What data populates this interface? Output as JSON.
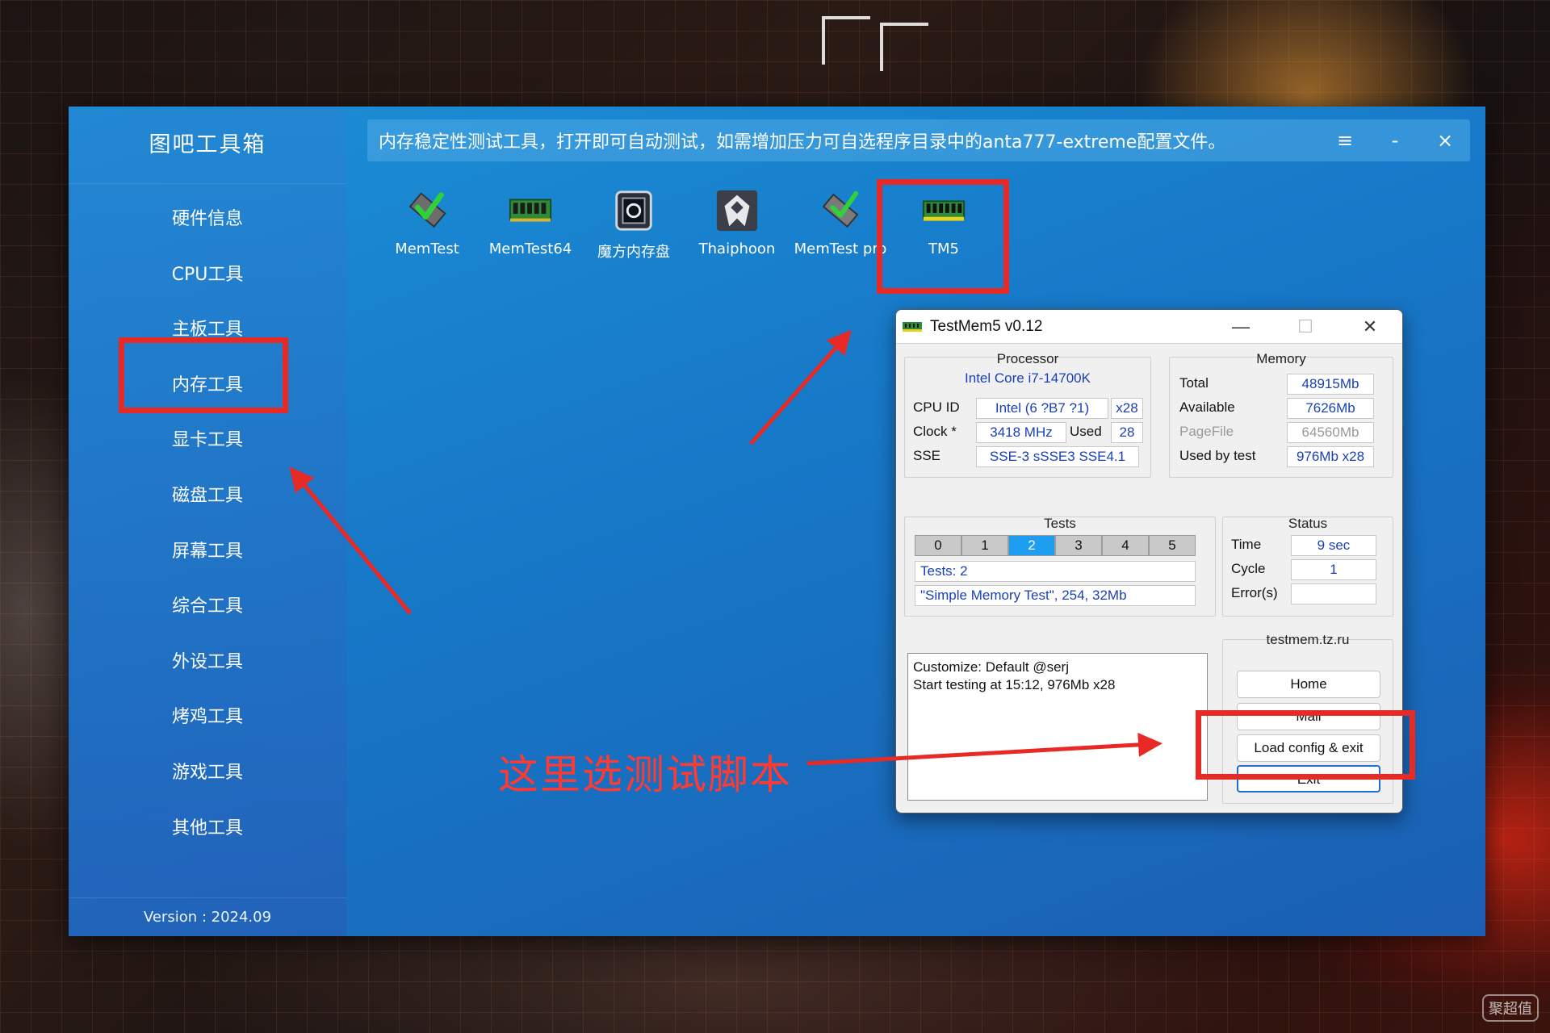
{
  "app": {
    "title": "图吧工具箱",
    "version": "Version : 2024.09",
    "description": "内存稳定性测试工具，打开即可自动测试，如需增加压力可自选程序目录中的anta777-extreme配置文件。",
    "window_controls": {
      "menu": "≡",
      "minimize": "-",
      "close": "×"
    }
  },
  "sidebar": {
    "items": [
      {
        "label": "硬件信息"
      },
      {
        "label": "CPU工具"
      },
      {
        "label": "主板工具"
      },
      {
        "label": "内存工具",
        "active": true
      },
      {
        "label": "显卡工具"
      },
      {
        "label": "磁盘工具"
      },
      {
        "label": "屏幕工具"
      },
      {
        "label": "综合工具"
      },
      {
        "label": "外设工具"
      },
      {
        "label": "烤鸡工具"
      },
      {
        "label": "游戏工具"
      },
      {
        "label": "其他工具"
      }
    ]
  },
  "tools": [
    {
      "label": "MemTest",
      "icon": "memtest-icon"
    },
    {
      "label": "MemTest64",
      "icon": "ram-stick-icon"
    },
    {
      "label": "魔方内存盘",
      "icon": "ramdisk-icon"
    },
    {
      "label": "Thaiphoon",
      "icon": "thaiphoon-icon"
    },
    {
      "label": "MemTest pro",
      "icon": "memtest-pro-icon"
    },
    {
      "label": "TM5",
      "icon": "tm5-icon"
    }
  ],
  "tm5": {
    "title": "TestMem5 v0.12",
    "controls": {
      "minimize": "—",
      "maximize": "☐",
      "close": "✕"
    },
    "processor": {
      "title": "Processor",
      "name": "Intel Core i7-14700K",
      "cpu_id_label": "CPU ID",
      "cpu_id": "Intel  (6 ?B7 ?1)",
      "threads": "x28",
      "clock_label": "Clock *",
      "clock": "3418 MHz",
      "used_label": "Used",
      "used": "28",
      "sse_label": "SSE",
      "sse": "SSE-3 sSSE3 SSE4.1"
    },
    "memory": {
      "title": "Memory",
      "total_label": "Total",
      "total": "48915Mb",
      "available_label": "Available",
      "available": "7626Mb",
      "pagefile_label": "PageFile",
      "pagefile": "64560Mb",
      "used_by_test_label": "Used by test",
      "used_by_test": "976Mb x28"
    },
    "tests": {
      "title": "Tests",
      "tabs": [
        "0",
        "1",
        "2",
        "3",
        "4",
        "5"
      ],
      "active_tab": "2",
      "count": "Tests: 2",
      "current": "\"Simple Memory Test\", 254, 32Mb"
    },
    "status": {
      "title": "Status",
      "time_label": "Time",
      "time": "9 sec",
      "cycle_label": "Cycle",
      "cycle": "1",
      "errors_label": "Error(s)",
      "errors": ""
    },
    "log": [
      "Customize: Default @serj",
      "Start testing at 15:12, 976Mb x28"
    ],
    "site": {
      "title": "testmem.tz.ru",
      "home": "Home",
      "mail": "Mail",
      "load_config": "Load config & exit",
      "exit": "Exit"
    }
  },
  "annotation": {
    "text": "这里选测试脚本",
    "color": "#e82a26"
  },
  "watermark": "聚超值"
}
